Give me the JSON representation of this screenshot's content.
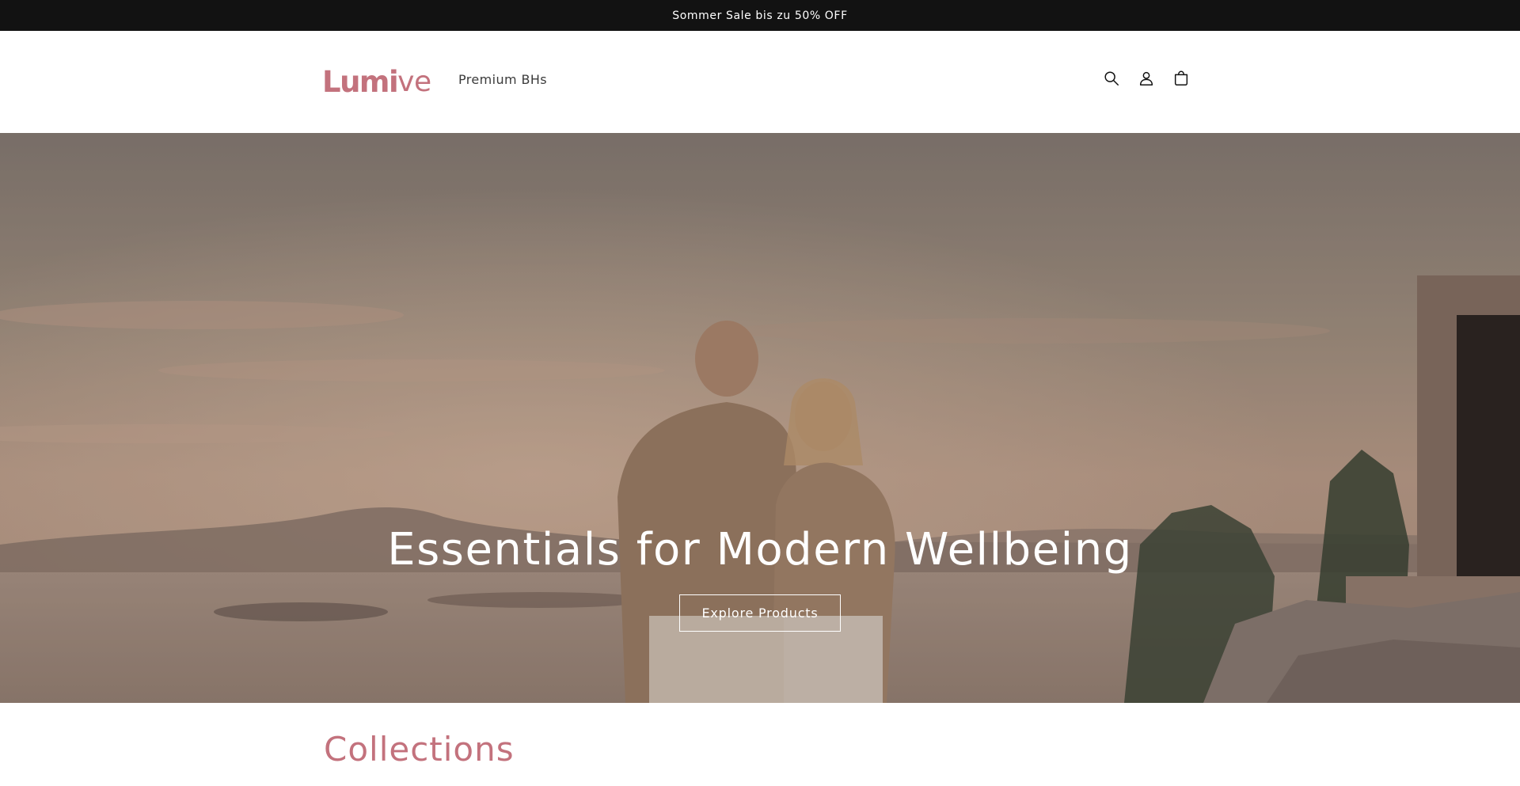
{
  "announcement": {
    "text": "Sommer Sale bis zu 50% OFF"
  },
  "header": {
    "logo": {
      "strong": "Lumi",
      "light": "ve"
    },
    "nav": [
      {
        "label": "Premium BHs"
      }
    ],
    "icons": [
      "search-icon",
      "account-icon",
      "cart-icon"
    ]
  },
  "hero": {
    "heading": "Essentials for Modern Wellbeing",
    "button_label": "Explore Products"
  },
  "collections": {
    "title": "Collections"
  },
  "colors": {
    "brand": "#c3727d",
    "announcement_bg": "#121212",
    "text": "#121212",
    "nav_text": "#3b3b3b"
  }
}
